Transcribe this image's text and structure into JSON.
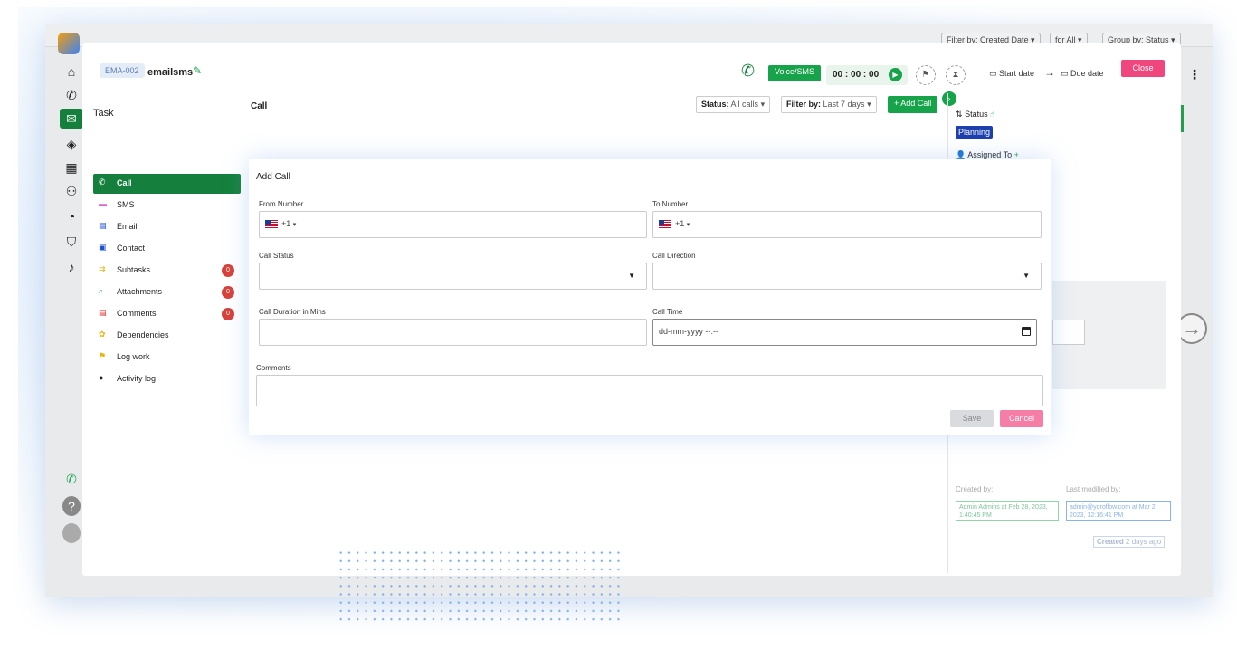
{
  "background_app": {
    "filters": [
      "Filter by: Created Date ▾",
      "for All ▾",
      "Group by: Status ▾"
    ],
    "sidebar_icons": [
      "home-icon",
      "phone-list-icon",
      "megaphone-icon",
      "tag-icon",
      "grid-icon",
      "team-icon",
      "shield-check-icon",
      "shield-icon",
      "bell-icon",
      "phone-green-icon",
      "help-icon",
      "avatar-icon"
    ]
  },
  "header": {
    "ticket_id": "EMA-002",
    "title": "emailsms",
    "voice_sms_label": "Voice/SMS",
    "timer": "00 : 00 : 00",
    "start_date_label": "Start date",
    "arrow": "→",
    "due_date_label": "Due date",
    "close_label": "Close"
  },
  "task_nav": {
    "heading": "Task",
    "items": [
      {
        "label": "Call",
        "icon": "phone-icon",
        "color": "#16a34a",
        "badge": ""
      },
      {
        "label": "SMS",
        "icon": "sms-icon",
        "color": "#e05fd0",
        "badge": ""
      },
      {
        "label": "Email",
        "icon": "email-icon",
        "color": "#1d4ed8",
        "badge": ""
      },
      {
        "label": "Contact",
        "icon": "contact-icon",
        "color": "#1d4ed8",
        "badge": ""
      },
      {
        "label": "Subtasks",
        "icon": "subtasks-icon",
        "color": "#eab308",
        "badge": "0"
      },
      {
        "label": "Attachments",
        "icon": "attachment-icon",
        "color": "#16a34a",
        "badge": "0"
      },
      {
        "label": "Comments",
        "icon": "comment-icon",
        "color": "#dc2626",
        "badge": "0"
      },
      {
        "label": "Dependencies",
        "icon": "dependencies-icon",
        "color": "#eab308",
        "badge": ""
      },
      {
        "label": "Log work",
        "icon": "flag-icon",
        "color": "#eab308",
        "badge": ""
      },
      {
        "label": "Activity log",
        "icon": "activity-icon",
        "color": "#222222",
        "badge": ""
      }
    ]
  },
  "call_section": {
    "heading": "Call",
    "status_label": "Status:",
    "status_value": "All calls",
    "filter_label": "Filter by:",
    "filter_value": "Last 7 days",
    "add_call_label": "+ Add Call"
  },
  "add_call_form": {
    "heading": "Add Call",
    "from_number_label": "From Number",
    "from_number_code": "+1",
    "to_number_label": "To Number",
    "to_number_code": "+1",
    "call_status_label": "Call Status",
    "call_direction_label": "Call Direction",
    "duration_label": "Call Duration in Mins",
    "call_time_label": "Call Time",
    "call_time_placeholder": "dd-mm-yyyy --:--",
    "comments_label": "Comments",
    "save_label": "Save",
    "cancel_label": "Cancel"
  },
  "right_panel": {
    "status_label": "Status",
    "status_value": "Planning",
    "assigned_label": "Assigned To",
    "created_by_label": "Created by:",
    "created_by_value": "Admin Admins at Feb 28, 2023, 1:40:45 PM",
    "modified_by_label": "Last modified by:",
    "modified_by_value": "admin@yoroflow.com at Mar 2, 2023, 12:16:41 PM",
    "created_ago_prefix": "Created",
    "created_ago_value": "2 days ago"
  },
  "colors": {
    "primary_green": "#16a34a",
    "close_pink": "#f0467e",
    "planning_blue": "#1e40af",
    "badge_red": "#d9413a"
  }
}
